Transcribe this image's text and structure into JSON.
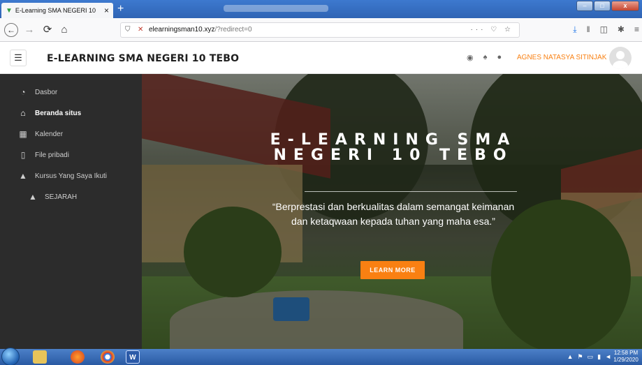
{
  "browser": {
    "tab_title": "E-Learning SMA NEGERI 10",
    "tab_close": "×",
    "new_tab": "+",
    "url_host": "elearningsman10.xyz",
    "url_path": "/?redirect=0",
    "url_actions": "··· ♡ ☆"
  },
  "header": {
    "menu_glyph": "☰",
    "site_name": "E-LEARNING SMA NEGERI 10 TEBO",
    "user_name": "AGNES NATASYA SITINJAK"
  },
  "sidebar": {
    "items": [
      {
        "label": "Dasbor",
        "icon": "dashboard-icon"
      },
      {
        "label": "Beranda situs",
        "icon": "home-icon"
      },
      {
        "label": "Kalender",
        "icon": "calendar-icon"
      },
      {
        "label": "File pribadi",
        "icon": "file-icon"
      },
      {
        "label": "Kursus Yang Saya Ikuti",
        "icon": "graduation-cap-icon"
      },
      {
        "label": "SEJARAH",
        "icon": "graduation-cap-icon"
      }
    ]
  },
  "hero": {
    "title": "E-LEARNING SMA NEGERI 10 TEBO",
    "subtitle": "“Berprestasi dan berkualitas dalam semangat keimanan dan ketaqwaan kepada tuhan yang maha esa.”",
    "button_label": "LEARN MORE"
  },
  "taskbar": {
    "time": "12:58 PM",
    "date": "1/29/2020",
    "word_label": "W"
  },
  "colors": {
    "accent": "#f98012",
    "sidebar_bg": "#2c2c2c",
    "taskbar": "#2a5aa3"
  }
}
